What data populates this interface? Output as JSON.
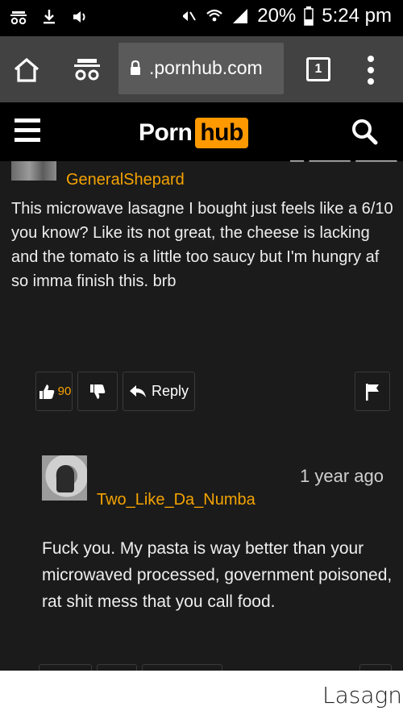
{
  "status_bar": {
    "battery_percent": "20%",
    "time": "5:24 pm",
    "icons": [
      "incognito-icon",
      "download-icon",
      "sound-icon",
      "mute-icon",
      "wifi-icon",
      "signal-icon",
      "battery-icon"
    ]
  },
  "browser": {
    "url": ".pornhub.com",
    "tab_count": "1"
  },
  "site": {
    "logo_part1": "Porn",
    "logo_part2": "hub",
    "accent_color": "#ff9900"
  },
  "comments": [
    {
      "username": "GeneralShepard",
      "text": "This microwave lasagne I bought just feels like a 6/10 you know? Like its not great, the cheese is lacking and the tomato is a little too saucy but I'm hungry af so imma finish this. brb",
      "upvotes": "90",
      "reply_label": "Reply"
    },
    {
      "username": "Two_Like_Da_Numba",
      "time_ago": "1 year ago",
      "text": "Fuck you. My pasta is way better than your microwaved processed, government poisoned, rat shit mess that you call food."
    }
  ],
  "caption": "Lasagna"
}
